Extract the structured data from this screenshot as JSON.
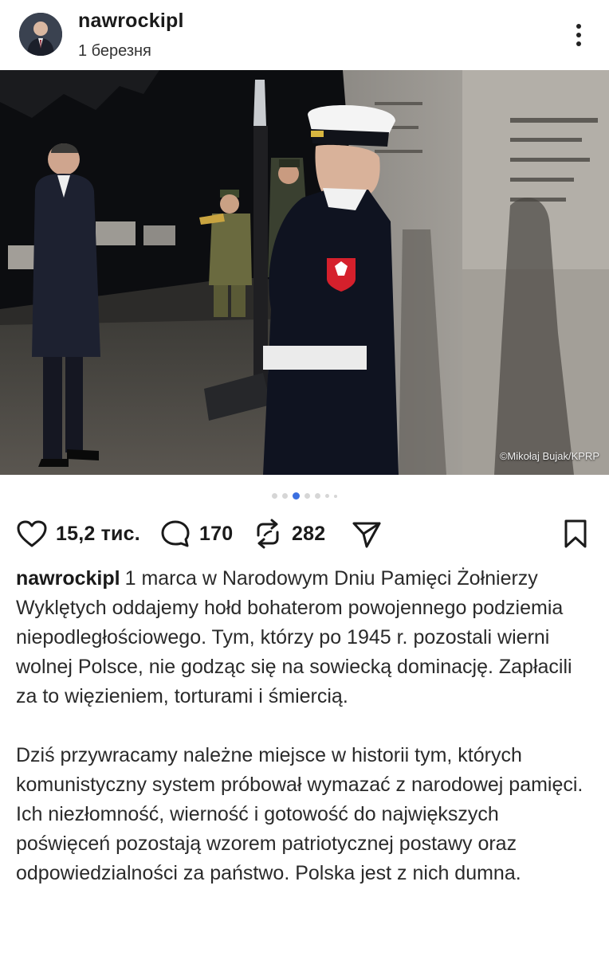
{
  "post": {
    "username": "nawrockipl",
    "date": "1 березня",
    "photo_credit": "©Mikołaj Bujak/KPRP",
    "carousel": {
      "total": 7,
      "active_index": 2
    }
  },
  "actions": {
    "likes": "15,2 тис.",
    "comments": "170",
    "reposts": "282"
  },
  "caption": {
    "username": "nawrockipl",
    "paragraph1": "1 marca w Narodowym Dniu Pamięci Żołnierzy Wyklętych oddajemy hołd bohaterom powojennego podziemia niepodległościowego. Tym, którzy po 1945 r. pozostali wierni wolnej Polsce, nie godząc się na sowiecką dominację. Zapłacili za to więzieniem, torturami i śmiercią.",
    "paragraph2": "Dziś przywracamy należne miejsce w historii tym, których komunistyczny system próbował wymazać z narodowej pamięci. Ich niezłomność, wierność i gotowość do największych poświęceń  pozostają wzorem patriotycznej postawy oraz odpowiedzialności za państwo. Polska jest z nich dumna."
  },
  "icons": {
    "more": "vertical-dots-icon",
    "like": "heart-icon",
    "comment": "comment-bubble-icon",
    "repost": "repost-arrows-icon",
    "share": "paper-plane-icon",
    "save": "bookmark-icon"
  },
  "colors": {
    "active_dot": "#3b6fe0",
    "inactive_dot": "#d6d6d6",
    "text": "#1a1a1a"
  }
}
